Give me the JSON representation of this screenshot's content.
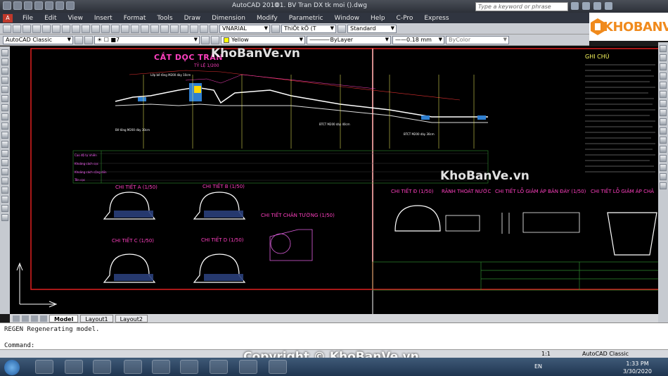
{
  "title_bar": {
    "app": "AutoCAD 2010",
    "document": "01. BV Tran DX tk moi ().dwg",
    "search_placeholder": "Type a keyword or phrase"
  },
  "menu": [
    "File",
    "Edit",
    "View",
    "Insert",
    "Format",
    "Tools",
    "Draw",
    "Dimension",
    "Modify",
    "Parametric",
    "Window",
    "Help",
    "C-Pro",
    "Express"
  ],
  "toolbar": {
    "workspace": "AutoCAD Classic",
    "layer": "7",
    "text_style": "VNARIAL",
    "dim_style": "ThiÕt kÕ (T",
    "table_style": "Standard",
    "color": "Yellow",
    "linetype": "ByLayer",
    "lineweight": "0.18 mm",
    "plotstyle": "ByColor"
  },
  "logo": "KHOBANVE",
  "drawing": {
    "main_title": "CẮT DỌC TRÀN",
    "main_scale": "TỶ LỆ 1/200",
    "notes_title": "GHI CHÚ",
    "details": [
      "CHI TIẾT A (1/50)",
      "CHI TIẾT B (1/50)",
      "CHI TIẾT C (1/50)",
      "CHI TIẾT D (1/50)",
      "CHI TIẾT CHÂN TƯỜNG (1/50)",
      "CHI TIẾT Đ (1/50)",
      "RÃNH THOÁT NƯỚC",
      "CHI TIẾT LỖ GIẢM ÁP BẢN ĐÁY (1/50)",
      "CHI TIẾT LỖ GIẢM ÁP CHÂ"
    ],
    "table_rows": [
      "Cao độ tự nhiên",
      "Khoảng cách cọc",
      "Khoảng cách cộng dồn",
      "Tên cọc"
    ]
  },
  "watermark": "KhoBanVe.vn",
  "layout_tabs": [
    "Model",
    "Layout1",
    "Layout2"
  ],
  "command": {
    "history": "REGEN Regenerating model.",
    "prompt": "Command:"
  },
  "status": {
    "scale": "1:1",
    "workspace": "AutoCAD Classic"
  },
  "copyright": "Copyright © KhoBanVe.vn",
  "taskbar": {
    "language": "EN",
    "time": "1:33 PM",
    "date": "3/30/2020"
  }
}
